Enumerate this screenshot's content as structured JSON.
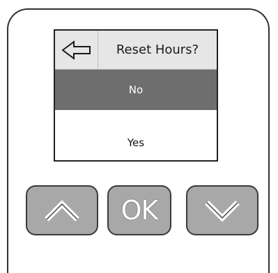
{
  "screen": {
    "title": "Reset Hours?",
    "back_icon": "arrow-left-icon",
    "options": [
      {
        "label": "No",
        "selected": true
      },
      {
        "label": "Yes",
        "selected": false
      }
    ]
  },
  "hardware_buttons": {
    "up_icon": "chevron-up-icon",
    "ok_label": "OK",
    "down_icon": "chevron-down-icon"
  },
  "colors": {
    "header_bg": "#e6e6e6",
    "selected_bg": "#6e6e6e",
    "button_bg": "#a8a8a8"
  }
}
